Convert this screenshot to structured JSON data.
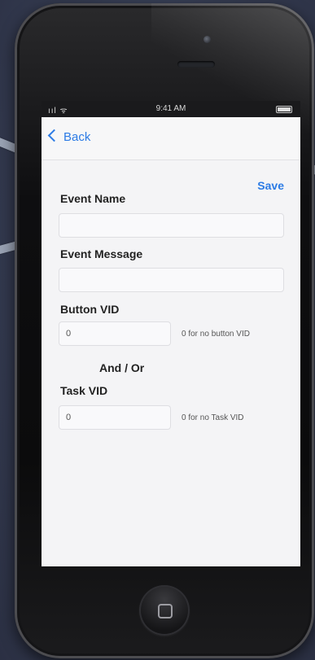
{
  "status_bar": {
    "signal": "ııl ᯤ",
    "time": "9:41 AM"
  },
  "nav": {
    "back_label": "Back",
    "save_label": "Save"
  },
  "form": {
    "event_name": {
      "label": "Event Name",
      "value": ""
    },
    "event_message": {
      "label": "Event Message",
      "value": ""
    },
    "button_vid": {
      "label": "Button VID",
      "value": "0",
      "hint": "0 for no button VID"
    },
    "and_or": "And / Or",
    "task_vid": {
      "label": "Task VID",
      "value": "0",
      "hint": "0 for no Task VID"
    }
  },
  "icons": [
    "back-chevron-icon",
    "battery-icon",
    "signal-icon",
    "wifi-icon",
    "home-button-icon"
  ],
  "colors": {
    "accent": "#2c7be5",
    "background": "#3a4257",
    "screen": "#f4f4f6",
    "phone_body": "#0e0e10"
  }
}
